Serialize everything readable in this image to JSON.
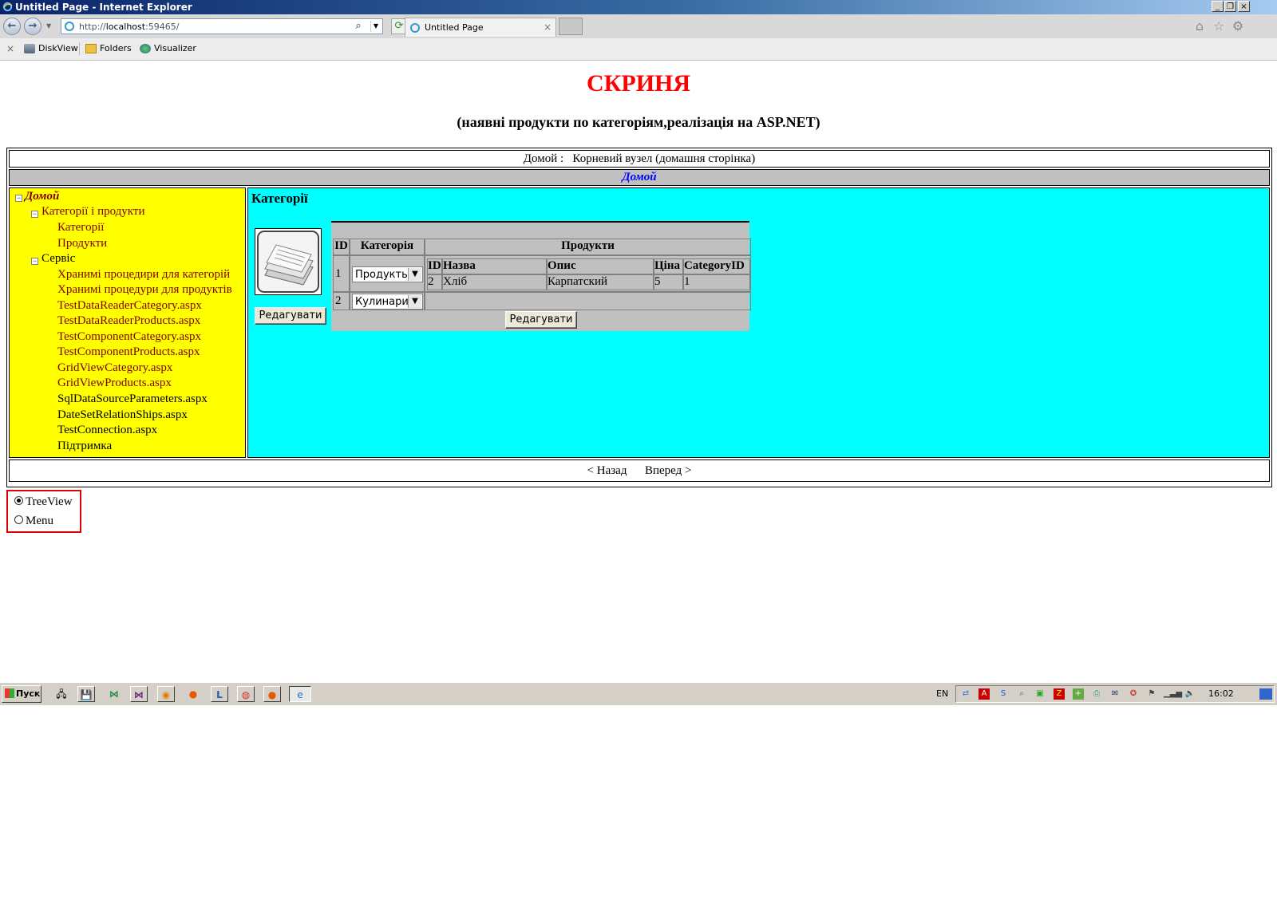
{
  "window": {
    "title": "Untitled Page - Internet Explorer"
  },
  "browser": {
    "url_prefix": "http://",
    "url_host": "localhost",
    "url_rest": ":59465/",
    "tab_title": "Untitled Page",
    "tab_close": "×"
  },
  "favorites": {
    "close": "×",
    "items": [
      {
        "label": "DiskView",
        "icon": "diskview-icon"
      },
      {
        "label": "Folders",
        "icon": "folder-icon"
      },
      {
        "label": "Visualizer",
        "icon": "visualizer-icon"
      }
    ]
  },
  "page": {
    "title": "СКРИНЯ",
    "subtitle": "(наявні продукти по категоріям,реалізація на ASP.NET)",
    "breadcrumb": "Домой :   Корневий вузел (домашня сторінка)",
    "nav_current": "Домой",
    "footer_nav": "< Назад      Вперед >",
    "tree": {
      "root": "Домой",
      "collapse_glyph": "−",
      "group1": "Категорії і продукти",
      "group1_items": [
        "Категорії",
        "Продукти"
      ],
      "group2": "Сервіс",
      "group2_items": [
        "Хранимі процедири для категорій",
        "Хранимі процедури для продуктів",
        "TestDataReaderCategory.aspx",
        "TestDataReaderProducts.aspx",
        "TestComponentCategory.aspx",
        "TestComponentProducts.aspx",
        "GridViewCategory.aspx",
        "GridViewProducts.aspx",
        "SqlDataSourceParameters.aspx",
        "DateSetRelationShips.aspx",
        "TestConnection.aspx"
      ],
      "support": "Підтримка"
    },
    "content": {
      "heading": "Категорії",
      "edit_button": "Редагувати",
      "grid": {
        "headers": [
          "ID",
          "Категорія",
          "Продукти"
        ],
        "rows": [
          {
            "id": "1",
            "category": "Продукты"
          },
          {
            "id": "2",
            "category": "Кулинария"
          }
        ],
        "products_headers": [
          "ID",
          "Назва",
          "Опис",
          "Ціна",
          "CategoryID"
        ],
        "products_rows": [
          [
            "2",
            "Хліб",
            "Карпатский",
            "5",
            "1"
          ]
        ],
        "edit_button": "Редагувати"
      }
    },
    "view_mode": {
      "options": [
        "TreeView",
        "Menu"
      ],
      "selected": "TreeView"
    }
  },
  "taskbar": {
    "start": "Пуск",
    "language": "EN",
    "clock": "16:02"
  },
  "colors": {
    "title_red": "#ff0000",
    "tree_bg": "#ffff00",
    "content_bg": "#00ffff",
    "grid_bg": "#c0c0c0",
    "link_maroon": "#800000",
    "nav_blue": "#0000ff"
  }
}
